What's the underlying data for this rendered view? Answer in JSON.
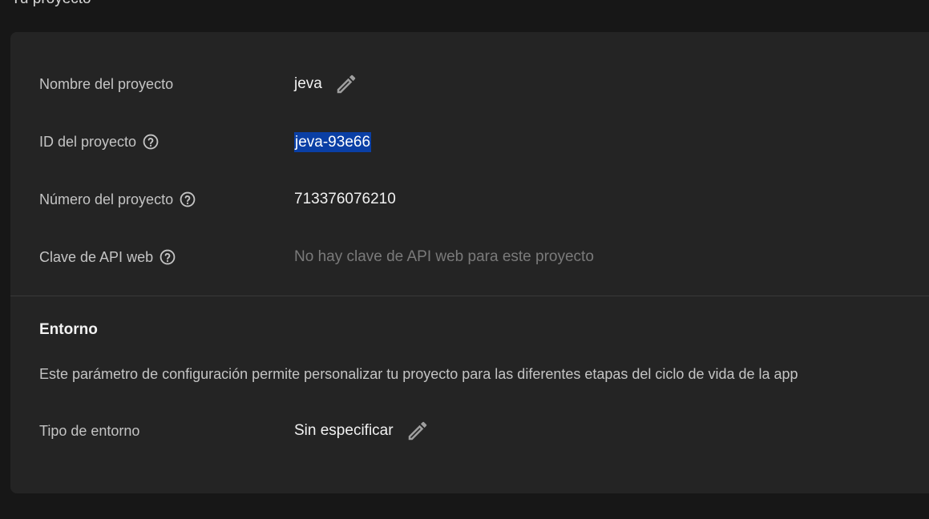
{
  "page": {
    "heading": "Tu proyecto"
  },
  "project": {
    "rows": [
      {
        "label": "Nombre del proyecto",
        "value": "jeva",
        "editable": true,
        "help": false
      },
      {
        "label": "ID del proyecto",
        "value": "jeva-93e66",
        "selected": true,
        "help": true
      },
      {
        "label": "Número del proyecto",
        "value": "713376076210",
        "help": true
      },
      {
        "label": "Clave de API web",
        "value": "No hay clave de API web para este proyecto",
        "muted": true,
        "help": true
      }
    ]
  },
  "environment": {
    "title": "Entorno",
    "description": "Este parámetro de configuración permite personalizar tu proyecto para las diferentes etapas del ciclo de vida de la app",
    "type_label": "Tipo de entorno",
    "type_value": "Sin especificar"
  },
  "colors": {
    "background": "#171717",
    "card": "#242424",
    "selection": "#0a3fa5",
    "muted_text": "#7a7a7a"
  },
  "icons": {
    "edit": "pencil-icon",
    "help": "help-circle-icon"
  }
}
